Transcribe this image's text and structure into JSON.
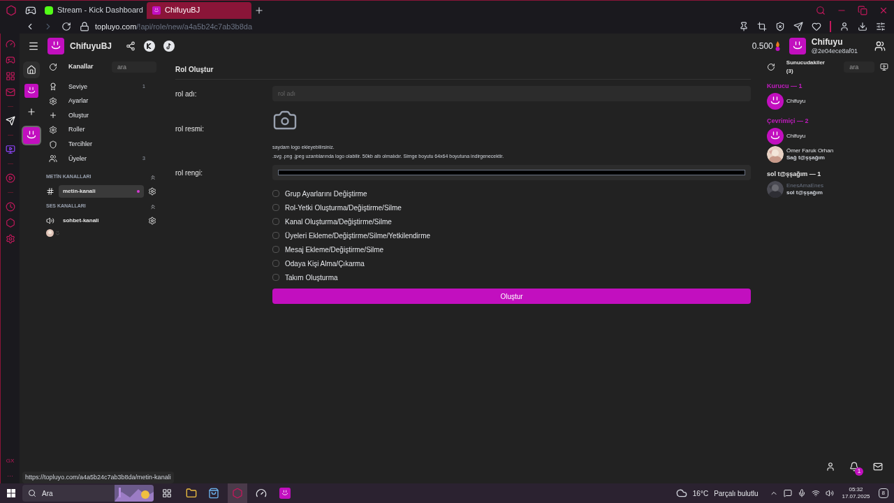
{
  "browser": {
    "tabs": [
      {
        "title": "Stream - Kick Dashboard",
        "selected": false,
        "kind": "kick"
      },
      {
        "title": "ChifuyuBJ",
        "selected": true,
        "kind": "smiley"
      }
    ],
    "address": {
      "host": "topluyo.com",
      "path": "/!api/role/new/a4a5b24c7ab3b8da"
    },
    "sidebar_labels": [
      "GX",
      "···"
    ],
    "status_url": "https://topluyo.com/a4a5b24c7ab3b8da/metin-kanali"
  },
  "header": {
    "server_name": "ChifuyuBJ",
    "balance": "0.500",
    "user_name": "Chifuyu",
    "user_handle": "@2e04ece8af01"
  },
  "servers": [
    {
      "kind": "home",
      "selected": true
    },
    {
      "kind": "avatar",
      "selected": false
    },
    {
      "kind": "add",
      "selected": false
    },
    {
      "kind": "avatar",
      "selected": true
    }
  ],
  "channels": {
    "title": "Kanallar",
    "search_placeholder": "ara",
    "menu": [
      {
        "label": "Seviye",
        "count": "1"
      },
      {
        "label": "Ayarlar"
      },
      {
        "label": "Oluştur"
      },
      {
        "label": "Roller"
      },
      {
        "label": "Tercihler"
      },
      {
        "label": "Üyeler",
        "count": "3"
      }
    ],
    "text_title": "METİN KANALLARI",
    "text_channels": [
      {
        "name": "metin-kanali",
        "selected": true,
        "unread": true
      }
    ],
    "voice_title": "SES KANALLARI",
    "voice_channels": [
      {
        "name": "sohbet-kanali",
        "selected": false
      }
    ]
  },
  "form": {
    "title": "Rol Oluştur",
    "name_label": "rol adı:",
    "name_placeholder": "rol adı",
    "image_label": "rol resmi:",
    "image_hint": "saydam logo ekleyebilirsiniz.",
    "image_rules": ".svg .png .jpeg uzantılarında logo olabilir. 50kb altı olmalıdır. Simge boyutu 64x64 boyutuna indirgenecektir.",
    "color_label": "rol rengi:",
    "permissions": [
      {
        "label": "Grup Ayarlarını Değiştirme",
        "checked": false
      },
      {
        "label": "Rol-Yetki Oluşturma/Değiştirme/Silme",
        "checked": false
      },
      {
        "label": "Kanal Oluşturma/Değiştirme/Silme",
        "checked": false
      },
      {
        "label": "Üyeleri Ekleme/Değiştirme/Silme/Yetkilendirme",
        "checked": false
      },
      {
        "label": "Mesaj Ekleme/Değiştirme/Silme",
        "checked": false
      },
      {
        "label": "Odaya Kişi Alma/Çıkarma",
        "checked": false
      },
      {
        "label": "Takım Oluşturma",
        "checked": false
      }
    ],
    "submit": "Oluştur"
  },
  "members": {
    "title": "Sunucudakiler (3)",
    "search_placeholder": "ara",
    "groups": [
      {
        "title": "Kurucu — 1",
        "color": "#c21cc0",
        "members": [
          {
            "name": "Chifuyu",
            "kind": "smiley"
          }
        ]
      },
      {
        "title": "Çevrimiçi — 2",
        "color": "#c21cc0",
        "members": [
          {
            "name": "Chifuyu",
            "kind": "smiley"
          },
          {
            "name": "Ömer Faruk Orhan",
            "role": "Sağ t@şşağım",
            "dimmed": false
          }
        ]
      },
      {
        "title": "sol t@şşağım — 1",
        "color": "#e5e5e5",
        "members": [
          {
            "name": "EnesAmaEnes",
            "role": "sol t@şşağım",
            "dimmed": true
          }
        ]
      }
    ],
    "notification_count": "1"
  },
  "taskbar": {
    "search": "Ara",
    "temperature": "16°C",
    "weather": "Parçalı bulutlu",
    "time": "05:32",
    "date": "17.07.2025",
    "notifications": "8"
  }
}
